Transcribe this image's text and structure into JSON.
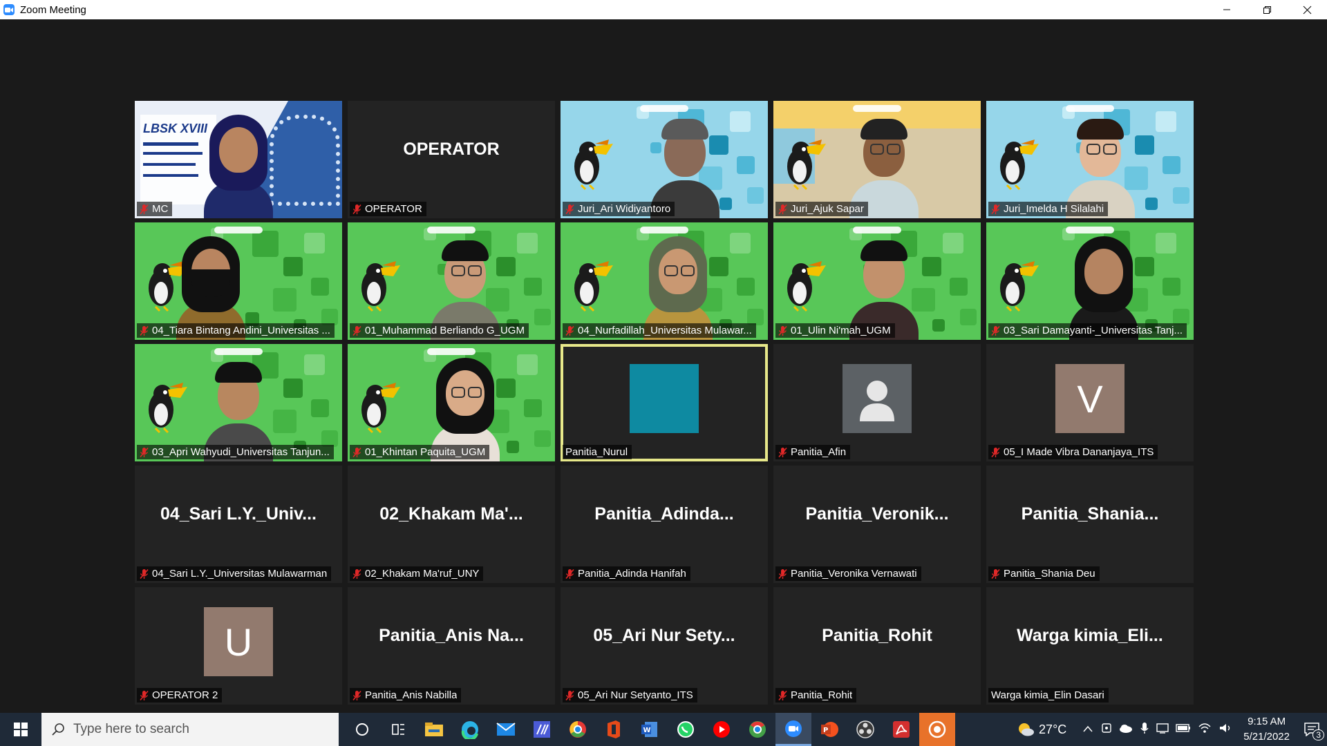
{
  "window": {
    "title": "Zoom Meeting"
  },
  "tiles": [
    {
      "name": "MC",
      "type": "video",
      "muted": true,
      "scene": "event",
      "banner": "LBSK XVIII"
    },
    {
      "name": "OPERATOR",
      "type": "name",
      "display": "OPERATOR",
      "muted": true
    },
    {
      "name": "Juri_Ari Widiyantoro",
      "type": "video",
      "muted": true,
      "scene": "blue"
    },
    {
      "name": "Juri_Ajuk Sapar",
      "type": "video",
      "muted": true,
      "scene": "room"
    },
    {
      "name": "Juri_Imelda H Silalahi",
      "type": "video",
      "muted": true,
      "scene": "blue"
    },
    {
      "name": "04_Tiara Bintang Andini_Universitas ...",
      "type": "video",
      "muted": true,
      "scene": "green"
    },
    {
      "name": "01_Muhammad Berliando G_UGM",
      "type": "video",
      "muted": true,
      "scene": "green"
    },
    {
      "name": "04_Nurfadillah_Universitas Mulawar...",
      "type": "video",
      "muted": true,
      "scene": "green"
    },
    {
      "name": "01_Ulin Ni'mah_UGM",
      "type": "video",
      "muted": true,
      "scene": "green"
    },
    {
      "name": "03_Sari Damayanti-_Universitas Tanj...",
      "type": "video",
      "muted": true,
      "scene": "green"
    },
    {
      "name": "03_Apri Wahyudi_Universitas Tanjun...",
      "type": "video",
      "muted": true,
      "scene": "green"
    },
    {
      "name": "01_Khintan Paquita_UGM",
      "type": "video",
      "muted": true,
      "scene": "green"
    },
    {
      "name": "Panitia_Nurul",
      "type": "avatar",
      "avatar_style": "teal",
      "muted": false,
      "active": true
    },
    {
      "name": "Panitia_Afin",
      "type": "avatar",
      "avatar_style": "person",
      "muted": true
    },
    {
      "name": "05_I Made Vibra Dananjaya_ITS",
      "type": "avatar",
      "avatar_style": "letter",
      "letter": "V",
      "muted": true
    },
    {
      "name": "04_Sari L.Y._Universitas Mulawarman",
      "type": "name",
      "display": "04_Sari  L.Y._Univ...",
      "muted": true
    },
    {
      "name": "02_Khakam Ma'ruf_UNY",
      "type": "name",
      "display": "02_Khakam  Ma'...",
      "muted": true
    },
    {
      "name": "Panitia_Adinda Hanifah",
      "type": "name",
      "display": "Panitia_Adinda...",
      "muted": true
    },
    {
      "name": "Panitia_Veronika Vernawati",
      "type": "name",
      "display": "Panitia_Veronik...",
      "muted": true
    },
    {
      "name": "Panitia_Shania Deu",
      "type": "name",
      "display": "Panitia_Shania...",
      "muted": true
    },
    {
      "name": "OPERATOR 2",
      "type": "avatar",
      "avatar_style": "letter",
      "letter": "U",
      "muted": true
    },
    {
      "name": "Panitia_Anis Nabilla",
      "type": "name",
      "display": "Panitia_Anis  Na...",
      "muted": true
    },
    {
      "name": "05_Ari Nur Setyanto_ITS",
      "type": "name",
      "display": "05_Ari  Nur  Sety...",
      "muted": true
    },
    {
      "name": "Panitia_Rohit",
      "type": "name",
      "display": "Panitia_Rohit",
      "muted": true
    },
    {
      "name": "Warga kimia_Elin Dasari",
      "type": "name",
      "display": "Warga  kimia_Eli...",
      "muted": false
    }
  ],
  "taskbar": {
    "search_placeholder": "Type here to search",
    "temperature": "27°C",
    "time": "9:15 AM",
    "date": "5/21/2022",
    "notification_count": "3"
  },
  "colors": {
    "background": "#1a1a1a",
    "active_border": "#e7e88a",
    "muted_red": "#e02828"
  }
}
